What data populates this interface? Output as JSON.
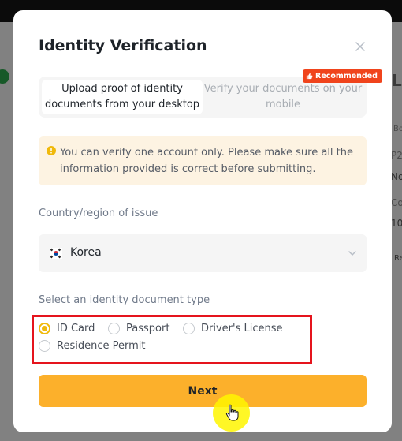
{
  "modal": {
    "title": "Identity Verification",
    "tabs": [
      {
        "label": "Upload proof of identity documents from your desktop",
        "active": true
      },
      {
        "label": "Verify your documents on your mobile",
        "active": false
      }
    ],
    "recommended_badge": "Recommended",
    "notice": "You can verify one account only. Please make sure all the information provided is correct before submitting.",
    "country_label": "Country/region of issue",
    "country_value": "Korea",
    "doc_type_label": "Select an identity document type",
    "doc_types": [
      {
        "label": "ID Card",
        "selected": true
      },
      {
        "label": "Passport",
        "selected": false
      },
      {
        "label": "Driver's License",
        "selected": false
      },
      {
        "label": "Residence Permit",
        "selected": false
      }
    ],
    "next_label": "Next"
  },
  "background": {
    "right_snippets": [
      "L",
      "Bo",
      "P2",
      "No",
      "Co",
      "10",
      "Re"
    ]
  },
  "colors": {
    "accent": "#fcb02b",
    "radio_selected": "#f0b90b",
    "badge": "#f0441c",
    "notice_bg": "#fdf3e2",
    "highlight_box": "#e5141d"
  }
}
